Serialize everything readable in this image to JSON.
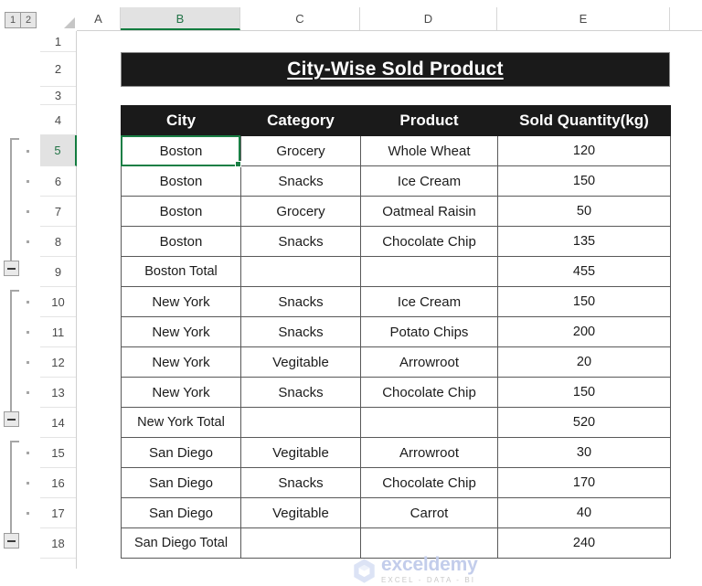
{
  "app": {
    "type": "spreadsheet",
    "accent_color": "#217346",
    "selected_cell": "B5"
  },
  "outline": {
    "level_buttons": [
      "1",
      "2"
    ],
    "collapse_icon": "minus-icon",
    "groups": [
      {
        "rows": [
          "5",
          "6",
          "7",
          "8"
        ],
        "total_row": "9"
      },
      {
        "rows": [
          "10",
          "11",
          "12",
          "13"
        ],
        "total_row": "14"
      },
      {
        "rows": [
          "15",
          "16",
          "17"
        ],
        "total_row": "18"
      }
    ]
  },
  "column_headers": [
    "A",
    "B",
    "C",
    "D",
    "E"
  ],
  "selected_column": "B",
  "row_headers": [
    "1",
    "2",
    "3",
    "4",
    "5",
    "6",
    "7",
    "8",
    "9",
    "10",
    "11",
    "12",
    "13",
    "14",
    "15",
    "16",
    "17",
    "18"
  ],
  "selected_row": "5",
  "sheet": {
    "title": "City-Wise Sold Product",
    "table": {
      "headers": [
        "City",
        "Category",
        "Product",
        "Sold Quantity(kg)"
      ],
      "rows": [
        {
          "type": "data",
          "cells": [
            "Boston",
            "Grocery",
            "Whole Wheat",
            "120"
          ]
        },
        {
          "type": "data",
          "cells": [
            "Boston",
            "Snacks",
            "Ice Cream",
            "150"
          ]
        },
        {
          "type": "data",
          "cells": [
            "Boston",
            "Grocery",
            "Oatmeal Raisin",
            "50"
          ]
        },
        {
          "type": "data",
          "cells": [
            "Boston",
            "Snacks",
            "Chocolate Chip",
            "135"
          ]
        },
        {
          "type": "total",
          "cells": [
            "Boston Total",
            "",
            "",
            "455"
          ]
        },
        {
          "type": "data",
          "cells": [
            "New York",
            "Snacks",
            "Ice Cream",
            "150"
          ]
        },
        {
          "type": "data",
          "cells": [
            "New York",
            "Snacks",
            "Potato Chips",
            "200"
          ]
        },
        {
          "type": "data",
          "cells": [
            "New York",
            "Vegitable",
            "Arrowroot",
            "20"
          ]
        },
        {
          "type": "data",
          "cells": [
            "New York",
            "Snacks",
            "Chocolate Chip",
            "150"
          ]
        },
        {
          "type": "total",
          "cells": [
            "New York Total",
            "",
            "",
            "520"
          ]
        },
        {
          "type": "data",
          "cells": [
            "San Diego",
            "Vegitable",
            "Arrowroot",
            "30"
          ]
        },
        {
          "type": "data",
          "cells": [
            "San Diego",
            "Snacks",
            "Chocolate Chip",
            "170"
          ]
        },
        {
          "type": "data",
          "cells": [
            "San Diego",
            "Vegitable",
            "Carrot",
            "40"
          ]
        },
        {
          "type": "total",
          "cells": [
            "San Diego Total",
            "",
            "",
            "240"
          ]
        }
      ]
    }
  },
  "watermark": {
    "name": "exceldemy",
    "tagline": "EXCEL - DATA - BI",
    "color": "#c3cdeb"
  }
}
